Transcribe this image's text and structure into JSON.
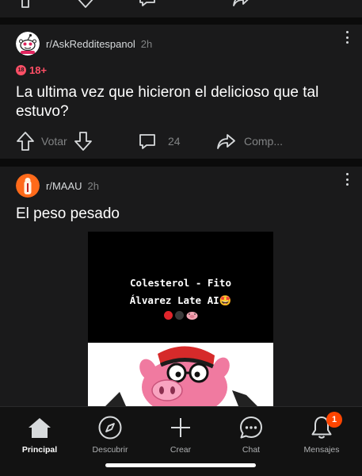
{
  "feed": {
    "posts": [
      {
        "subreddit": "r/AskRedditespanol",
        "age": "2h",
        "nsfw_label": "18+",
        "nsfw_icon_text": "18",
        "title": "La ultima vez que hicieron el delicioso que tal estuvo?",
        "vote_label": "Votar",
        "comment_count": "24",
        "share_label": "Comp..."
      },
      {
        "subreddit": "r/MAAU",
        "age": "2h",
        "title": "El peso pesado",
        "media_caption": "Colesterol - Fito\nÁlvarez Late AI🤩"
      }
    ]
  },
  "bottom_nav": {
    "tabs": [
      {
        "label": "Principal",
        "icon": "home-icon",
        "active": true
      },
      {
        "label": "Descubrir",
        "icon": "compass-icon"
      },
      {
        "label": "Crear",
        "icon": "plus-icon"
      },
      {
        "label": "Chat",
        "icon": "chat-icon"
      },
      {
        "label": "Mensajes",
        "icon": "bell-icon",
        "badge": "1"
      }
    ]
  },
  "colors": {
    "background": "#000000",
    "card": "#1a1a1b",
    "nsfw": "#ff4f66",
    "badge": "#ff4500",
    "muted_text": "#818384"
  }
}
